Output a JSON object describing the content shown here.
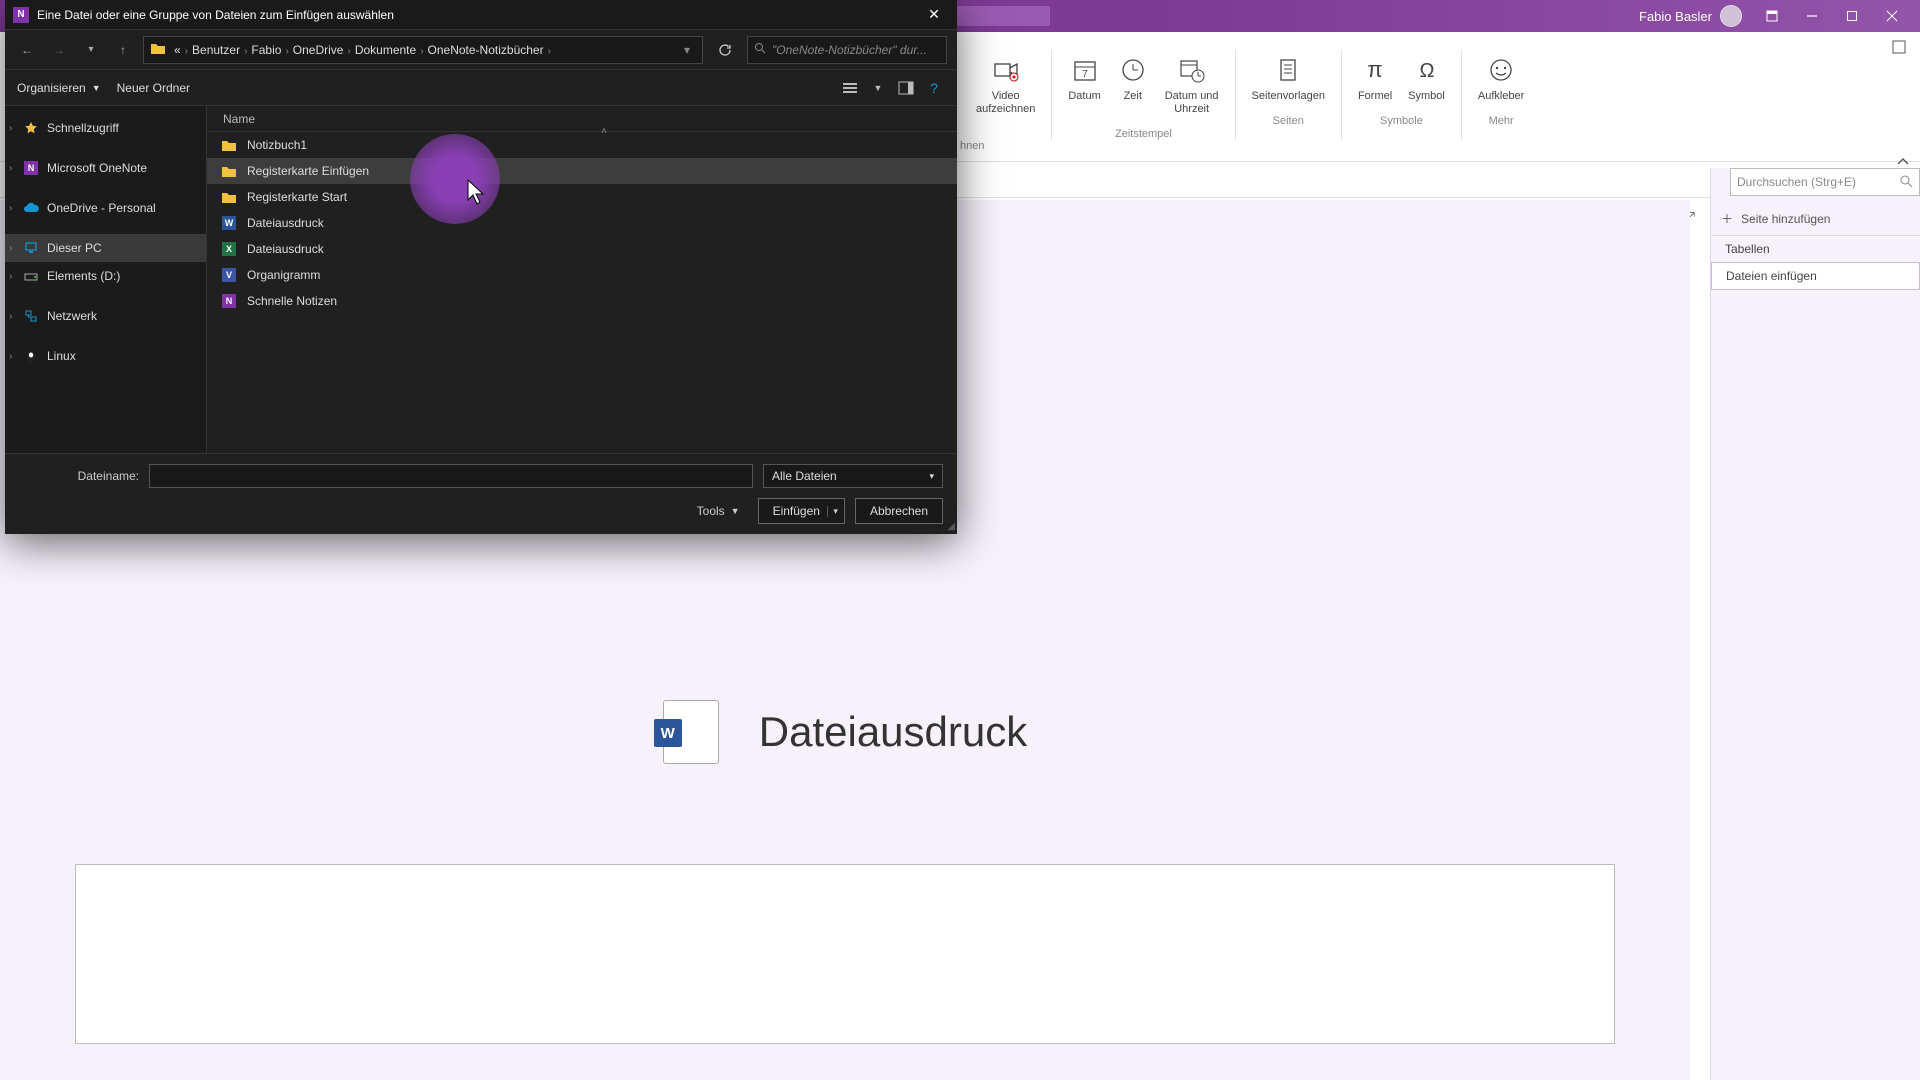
{
  "app": {
    "username": "Fabio Basler"
  },
  "ribbon": {
    "groups": [
      {
        "label": "",
        "items": [
          {
            "label": "Video\naufzeichnen",
            "icon": "video"
          }
        ]
      },
      {
        "label": "Zeitstempel",
        "items": [
          {
            "label": "Datum",
            "icon": "calendar"
          },
          {
            "label": "Zeit",
            "icon": "clock"
          },
          {
            "label": "Datum und\nUhrzeit",
            "icon": "cal-clock"
          }
        ]
      },
      {
        "label": "Seiten",
        "items": [
          {
            "label": "Seitenvorlagen",
            "icon": "page"
          }
        ]
      },
      {
        "label": "Symbole",
        "items": [
          {
            "label": "Formel",
            "icon": "pi"
          },
          {
            "label": "Symbol",
            "icon": "omega"
          }
        ]
      },
      {
        "label": "Mehr",
        "items": [
          {
            "label": "Aufkleber",
            "icon": "sticker"
          }
        ]
      }
    ],
    "partial_left_label": "hnen"
  },
  "rightPanel": {
    "searchPlaceholder": "Durchsuchen (Strg+E)",
    "addPage": "Seite hinzufügen",
    "pages": [
      {
        "label": "Tabellen",
        "active": false
      },
      {
        "label": "Dateien einfügen",
        "active": true
      }
    ]
  },
  "content": {
    "heading": "Dateiausdruck"
  },
  "dialog": {
    "title": "Eine Datei oder eine Gruppe von Dateien zum Einfügen auswählen",
    "breadcrumbs": [
      "«",
      "Benutzer",
      "Fabio",
      "OneDrive",
      "Dokumente",
      "OneNote-Notizbücher"
    ],
    "searchPlaceholder": "\"OneNote-Notizbücher\" dur...",
    "organize": "Organisieren",
    "newFolder": "Neuer Ordner",
    "columnName": "Name",
    "tree": [
      {
        "label": "Schnellzugriff",
        "icon": "star",
        "color": "#f0c040"
      },
      {
        "label": "Microsoft OneNote",
        "icon": "onenote",
        "color": "#8033a8"
      },
      {
        "label": "OneDrive - Personal",
        "icon": "cloud",
        "color": "#1496d4"
      },
      {
        "label": "Dieser PC",
        "icon": "pc",
        "color": "#1496d4",
        "selected": true
      },
      {
        "label": "Elements (D:)",
        "icon": "drive",
        "color": "#999"
      },
      {
        "label": "Netzwerk",
        "icon": "net",
        "color": "#1496d4"
      },
      {
        "label": "Linux",
        "icon": "linux",
        "color": "#ccc"
      }
    ],
    "files": [
      {
        "name": "Notizbuch1",
        "type": "folder"
      },
      {
        "name": "Registerkarte Einfügen",
        "type": "folder",
        "selected": true
      },
      {
        "name": "Registerkarte Start",
        "type": "folder"
      },
      {
        "name": "Dateiausdruck",
        "type": "word"
      },
      {
        "name": "Dateiausdruck",
        "type": "excel"
      },
      {
        "name": "Organigramm",
        "type": "visio"
      },
      {
        "name": "Schnelle Notizen",
        "type": "onenote"
      }
    ],
    "filenameLabel": "Dateiname:",
    "filetypeValue": "Alle Dateien",
    "tools": "Tools",
    "insert": "Einfügen",
    "cancel": "Abbrechen"
  }
}
